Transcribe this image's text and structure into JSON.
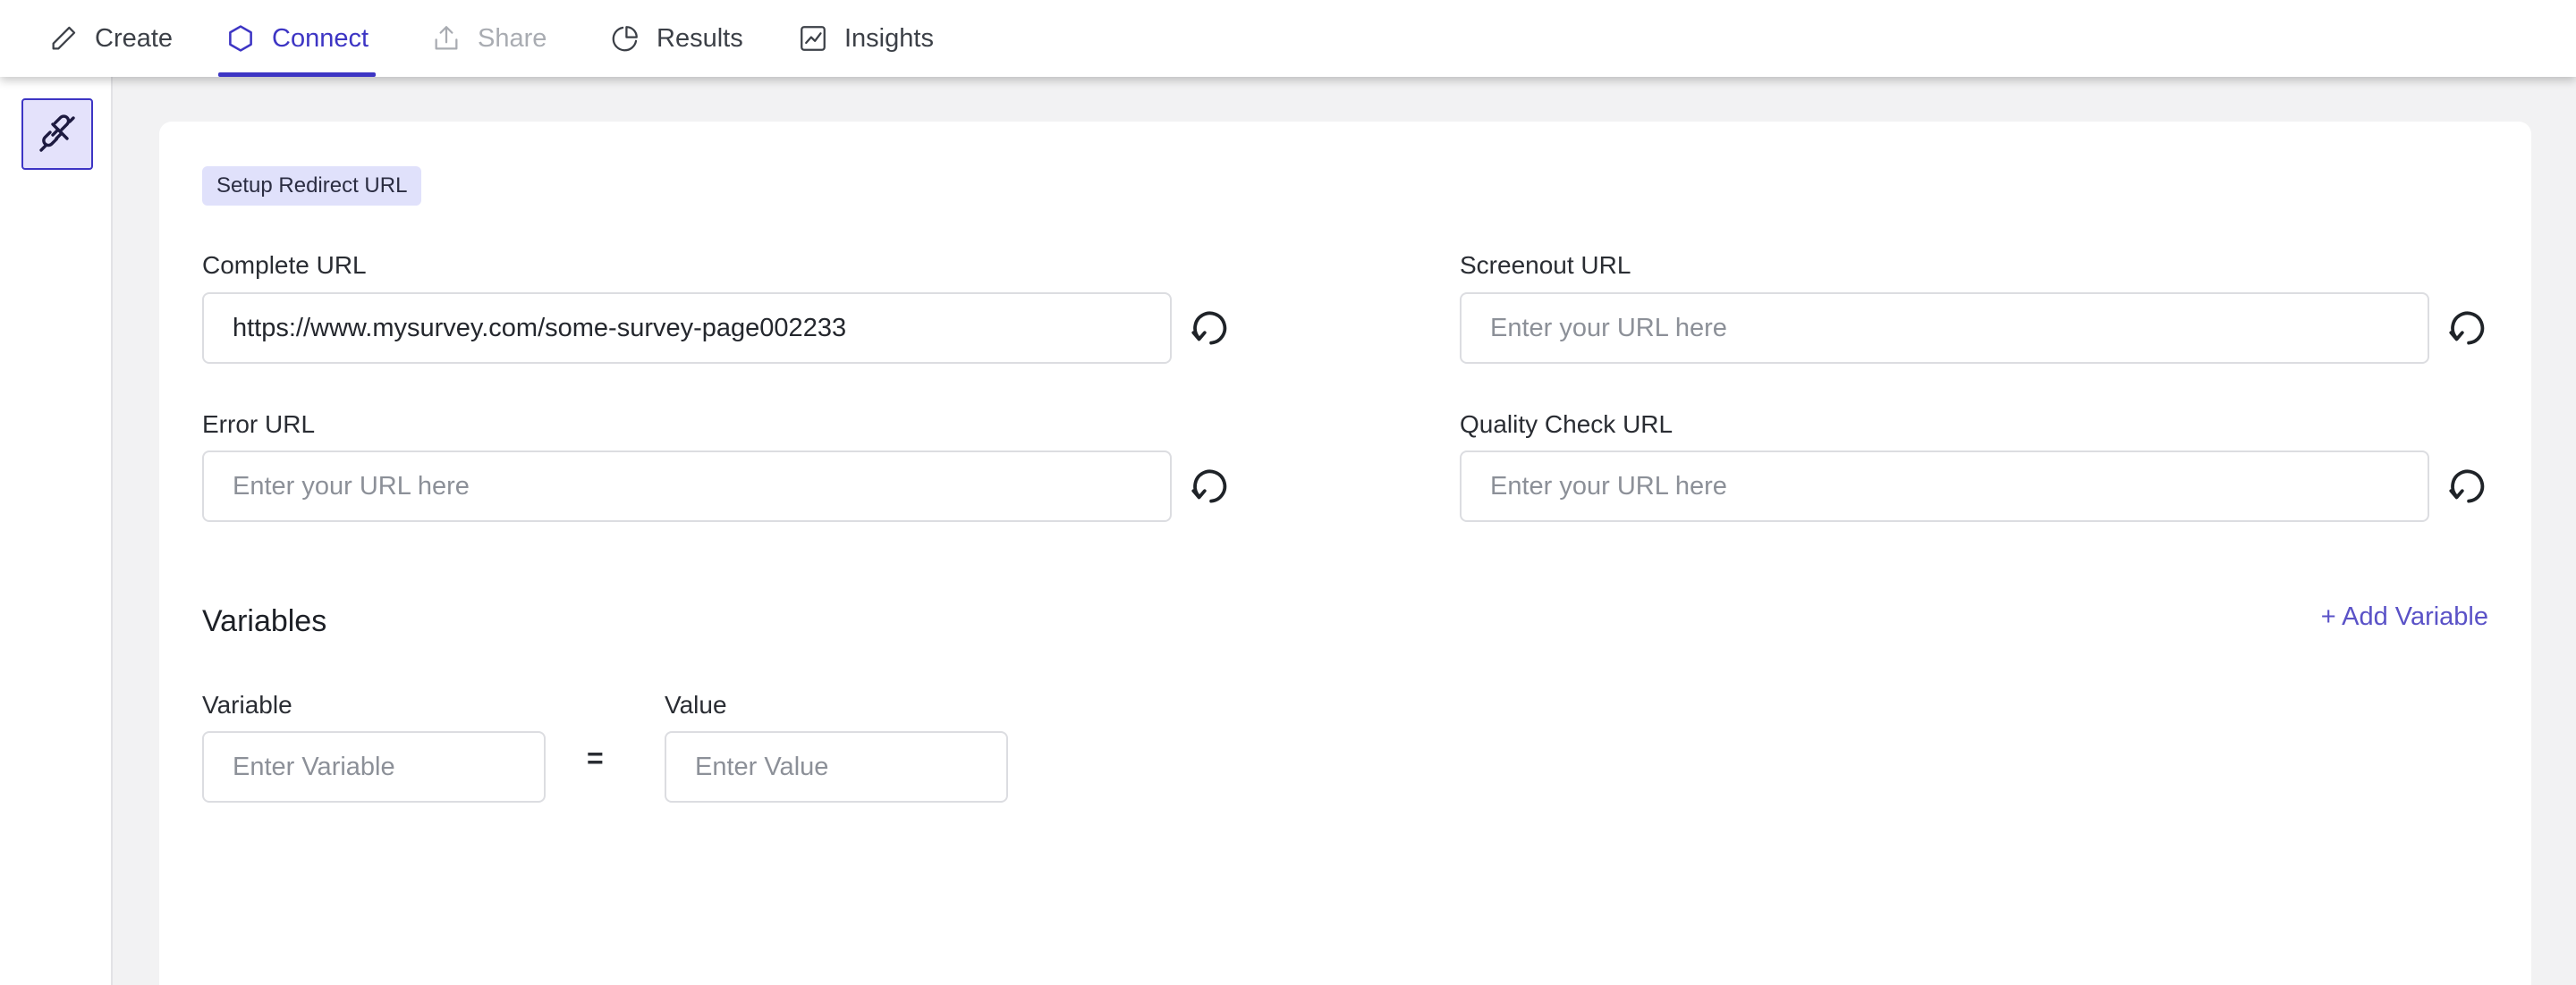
{
  "nav": {
    "tabs": [
      {
        "label": "Create",
        "icon": "pencil-icon",
        "state": "default"
      },
      {
        "label": "Connect",
        "icon": "hexagon-icon",
        "state": "active"
      },
      {
        "label": "Share",
        "icon": "share-upload-icon",
        "state": "disabled"
      },
      {
        "label": "Results",
        "icon": "pie-chart-icon",
        "state": "default"
      },
      {
        "label": "Insights",
        "icon": "line-chart-icon",
        "state": "default"
      }
    ],
    "accent_color": "#3d35c4"
  },
  "rail": {
    "active_icon": "plug-connect-icon"
  },
  "setup": {
    "badge": "Setup Redirect URL",
    "complete_url": {
      "label": "Complete URL",
      "value": "https://www.mysurvey.com/some-survey-page002233",
      "placeholder": "Enter your URL here"
    },
    "screenout_url": {
      "label": "Screenout URL",
      "value": "",
      "placeholder": "Enter your URL here"
    },
    "error_url": {
      "label": "Error URL",
      "value": "",
      "placeholder": "Enter your URL here"
    },
    "quality_check_url": {
      "label": "Quality Check URL",
      "value": "",
      "placeholder": "Enter your URL here"
    }
  },
  "variables": {
    "title": "Variables",
    "add_label": "+ Add Variable",
    "variable_label": "Variable",
    "variable_placeholder": "Enter Variable",
    "equals": "=",
    "value_label": "Value",
    "value_placeholder": "Enter Value"
  }
}
